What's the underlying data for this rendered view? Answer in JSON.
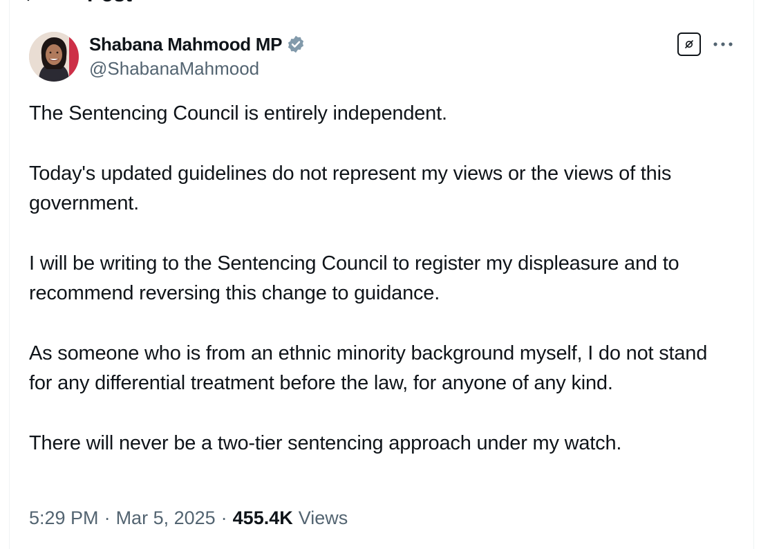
{
  "header": {
    "title": "Post"
  },
  "author": {
    "display_name": "Shabana Mahmood MP",
    "handle": "@ShabanaMahmood",
    "verified_color": "#829aab"
  },
  "tweet": {
    "paragraphs": [
      "The Sentencing Council is entirely independent.",
      "Today's updated guidelines do not represent my views or the views of this government.",
      "I will be writing to the Sentencing Council to register my displeasure and to recommend reversing this change to guidance.",
      "As someone who is from an ethnic minority background myself, I do not stand for any differential treatment before the law, for anyone of any kind.",
      "There will never be a two-tier sentencing approach under my watch."
    ]
  },
  "meta": {
    "time": "5:29 PM",
    "separator": "·",
    "date": "Mar 5, 2025",
    "views_count": "455.4K",
    "views_label": "Views"
  },
  "icons": {
    "back": "back-arrow-icon",
    "verified": "verified-badge-icon",
    "grok": "grok-icon",
    "more": "more-icon"
  }
}
